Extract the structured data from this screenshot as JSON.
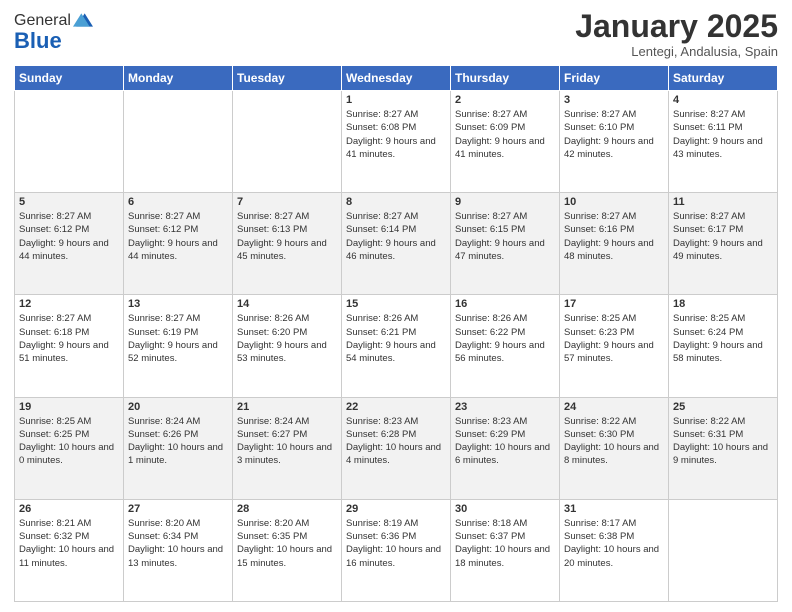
{
  "logo": {
    "general": "General",
    "blue": "Blue"
  },
  "header": {
    "month": "January 2025",
    "location": "Lentegi, Andalusia, Spain"
  },
  "days_header": [
    "Sunday",
    "Monday",
    "Tuesday",
    "Wednesday",
    "Thursday",
    "Friday",
    "Saturday"
  ],
  "weeks": [
    [
      {
        "day": "",
        "info": ""
      },
      {
        "day": "",
        "info": ""
      },
      {
        "day": "",
        "info": ""
      },
      {
        "day": "1",
        "info": "Sunrise: 8:27 AM\nSunset: 6:08 PM\nDaylight: 9 hours and 41 minutes."
      },
      {
        "day": "2",
        "info": "Sunrise: 8:27 AM\nSunset: 6:09 PM\nDaylight: 9 hours and 41 minutes."
      },
      {
        "day": "3",
        "info": "Sunrise: 8:27 AM\nSunset: 6:10 PM\nDaylight: 9 hours and 42 minutes."
      },
      {
        "day": "4",
        "info": "Sunrise: 8:27 AM\nSunset: 6:11 PM\nDaylight: 9 hours and 43 minutes."
      }
    ],
    [
      {
        "day": "5",
        "info": "Sunrise: 8:27 AM\nSunset: 6:12 PM\nDaylight: 9 hours and 44 minutes."
      },
      {
        "day": "6",
        "info": "Sunrise: 8:27 AM\nSunset: 6:12 PM\nDaylight: 9 hours and 44 minutes."
      },
      {
        "day": "7",
        "info": "Sunrise: 8:27 AM\nSunset: 6:13 PM\nDaylight: 9 hours and 45 minutes."
      },
      {
        "day": "8",
        "info": "Sunrise: 8:27 AM\nSunset: 6:14 PM\nDaylight: 9 hours and 46 minutes."
      },
      {
        "day": "9",
        "info": "Sunrise: 8:27 AM\nSunset: 6:15 PM\nDaylight: 9 hours and 47 minutes."
      },
      {
        "day": "10",
        "info": "Sunrise: 8:27 AM\nSunset: 6:16 PM\nDaylight: 9 hours and 48 minutes."
      },
      {
        "day": "11",
        "info": "Sunrise: 8:27 AM\nSunset: 6:17 PM\nDaylight: 9 hours and 49 minutes."
      }
    ],
    [
      {
        "day": "12",
        "info": "Sunrise: 8:27 AM\nSunset: 6:18 PM\nDaylight: 9 hours and 51 minutes."
      },
      {
        "day": "13",
        "info": "Sunrise: 8:27 AM\nSunset: 6:19 PM\nDaylight: 9 hours and 52 minutes."
      },
      {
        "day": "14",
        "info": "Sunrise: 8:26 AM\nSunset: 6:20 PM\nDaylight: 9 hours and 53 minutes."
      },
      {
        "day": "15",
        "info": "Sunrise: 8:26 AM\nSunset: 6:21 PM\nDaylight: 9 hours and 54 minutes."
      },
      {
        "day": "16",
        "info": "Sunrise: 8:26 AM\nSunset: 6:22 PM\nDaylight: 9 hours and 56 minutes."
      },
      {
        "day": "17",
        "info": "Sunrise: 8:25 AM\nSunset: 6:23 PM\nDaylight: 9 hours and 57 minutes."
      },
      {
        "day": "18",
        "info": "Sunrise: 8:25 AM\nSunset: 6:24 PM\nDaylight: 9 hours and 58 minutes."
      }
    ],
    [
      {
        "day": "19",
        "info": "Sunrise: 8:25 AM\nSunset: 6:25 PM\nDaylight: 10 hours and 0 minutes."
      },
      {
        "day": "20",
        "info": "Sunrise: 8:24 AM\nSunset: 6:26 PM\nDaylight: 10 hours and 1 minute."
      },
      {
        "day": "21",
        "info": "Sunrise: 8:24 AM\nSunset: 6:27 PM\nDaylight: 10 hours and 3 minutes."
      },
      {
        "day": "22",
        "info": "Sunrise: 8:23 AM\nSunset: 6:28 PM\nDaylight: 10 hours and 4 minutes."
      },
      {
        "day": "23",
        "info": "Sunrise: 8:23 AM\nSunset: 6:29 PM\nDaylight: 10 hours and 6 minutes."
      },
      {
        "day": "24",
        "info": "Sunrise: 8:22 AM\nSunset: 6:30 PM\nDaylight: 10 hours and 8 minutes."
      },
      {
        "day": "25",
        "info": "Sunrise: 8:22 AM\nSunset: 6:31 PM\nDaylight: 10 hours and 9 minutes."
      }
    ],
    [
      {
        "day": "26",
        "info": "Sunrise: 8:21 AM\nSunset: 6:32 PM\nDaylight: 10 hours and 11 minutes."
      },
      {
        "day": "27",
        "info": "Sunrise: 8:20 AM\nSunset: 6:34 PM\nDaylight: 10 hours and 13 minutes."
      },
      {
        "day": "28",
        "info": "Sunrise: 8:20 AM\nSunset: 6:35 PM\nDaylight: 10 hours and 15 minutes."
      },
      {
        "day": "29",
        "info": "Sunrise: 8:19 AM\nSunset: 6:36 PM\nDaylight: 10 hours and 16 minutes."
      },
      {
        "day": "30",
        "info": "Sunrise: 8:18 AM\nSunset: 6:37 PM\nDaylight: 10 hours and 18 minutes."
      },
      {
        "day": "31",
        "info": "Sunrise: 8:17 AM\nSunset: 6:38 PM\nDaylight: 10 hours and 20 minutes."
      },
      {
        "day": "",
        "info": ""
      }
    ]
  ]
}
